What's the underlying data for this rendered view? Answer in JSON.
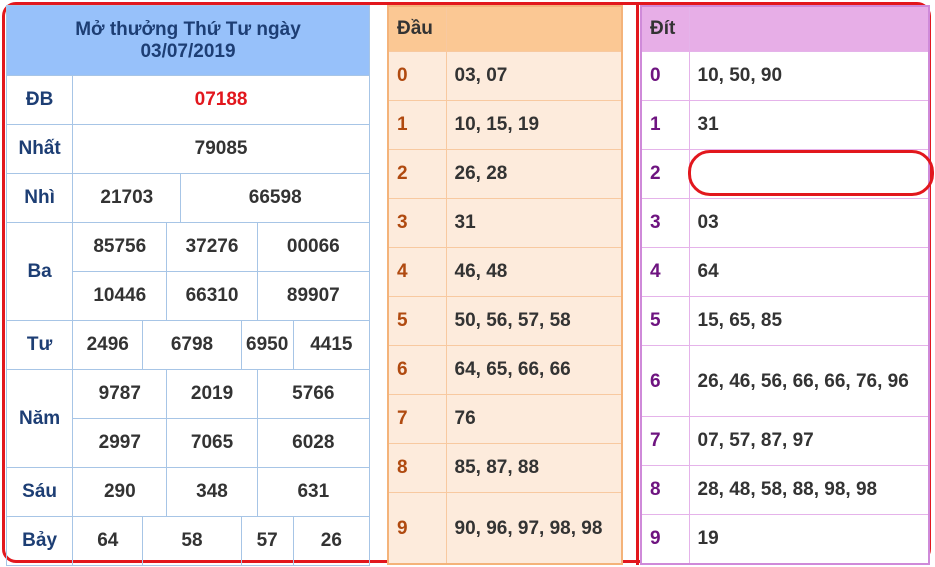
{
  "results": {
    "title_line1": "Mở thưởng Thứ Tư ngày",
    "title_line2": "03/07/2019",
    "prizes": {
      "db": {
        "label": "ĐB",
        "values": [
          "07188"
        ]
      },
      "nhat": {
        "label": "Nhất",
        "values": [
          "79085"
        ]
      },
      "nhi": {
        "label": "Nhì",
        "values": [
          "21703",
          "66598"
        ]
      },
      "ba": {
        "label": "Ba",
        "values": [
          "85756",
          "37276",
          "00066",
          "10446",
          "66310",
          "89907"
        ]
      },
      "tu": {
        "label": "Tư",
        "values": [
          "2496",
          "6798",
          "6950",
          "4415"
        ]
      },
      "nam": {
        "label": "Năm",
        "values": [
          "9787",
          "2019",
          "5766",
          "2997",
          "7065",
          "6028"
        ]
      },
      "sau": {
        "label": "Sáu",
        "values": [
          "290",
          "348",
          "631"
        ]
      },
      "bay": {
        "label": "Bảy",
        "values": [
          "64",
          "58",
          "57",
          "26"
        ]
      }
    },
    "colors": {
      "header_bg": "#97c1fa",
      "special_prize": "#e2171d"
    }
  },
  "dau": {
    "header": "Đầu",
    "rows": [
      {
        "key": "0",
        "value": "03, 07"
      },
      {
        "key": "1",
        "value": "10, 15, 19"
      },
      {
        "key": "2",
        "value": "26, 28"
      },
      {
        "key": "3",
        "value": "31"
      },
      {
        "key": "4",
        "value": "46, 48"
      },
      {
        "key": "5",
        "value": "50, 56, 57, 58"
      },
      {
        "key": "6",
        "value": "64, 65, 66, 66"
      },
      {
        "key": "7",
        "value": "76"
      },
      {
        "key": "8",
        "value": "85, 87, 88"
      },
      {
        "key": "9",
        "value": "90, 96, 97, 98, 98"
      }
    ]
  },
  "dit": {
    "header": "Đít",
    "rows": [
      {
        "key": "0",
        "value": "10, 50, 90"
      },
      {
        "key": "1",
        "value": "31"
      },
      {
        "key": "2",
        "value": ""
      },
      {
        "key": "3",
        "value": "03"
      },
      {
        "key": "4",
        "value": "64"
      },
      {
        "key": "5",
        "value": "15, 65, 85"
      },
      {
        "key": "6",
        "value": "26, 46, 56, 66, 66, 76, 96"
      },
      {
        "key": "7",
        "value": "07, 57, 87, 97"
      },
      {
        "key": "8",
        "value": "28, 48, 58, 88, 98, 98"
      },
      {
        "key": "9",
        "value": "19"
      }
    ]
  }
}
